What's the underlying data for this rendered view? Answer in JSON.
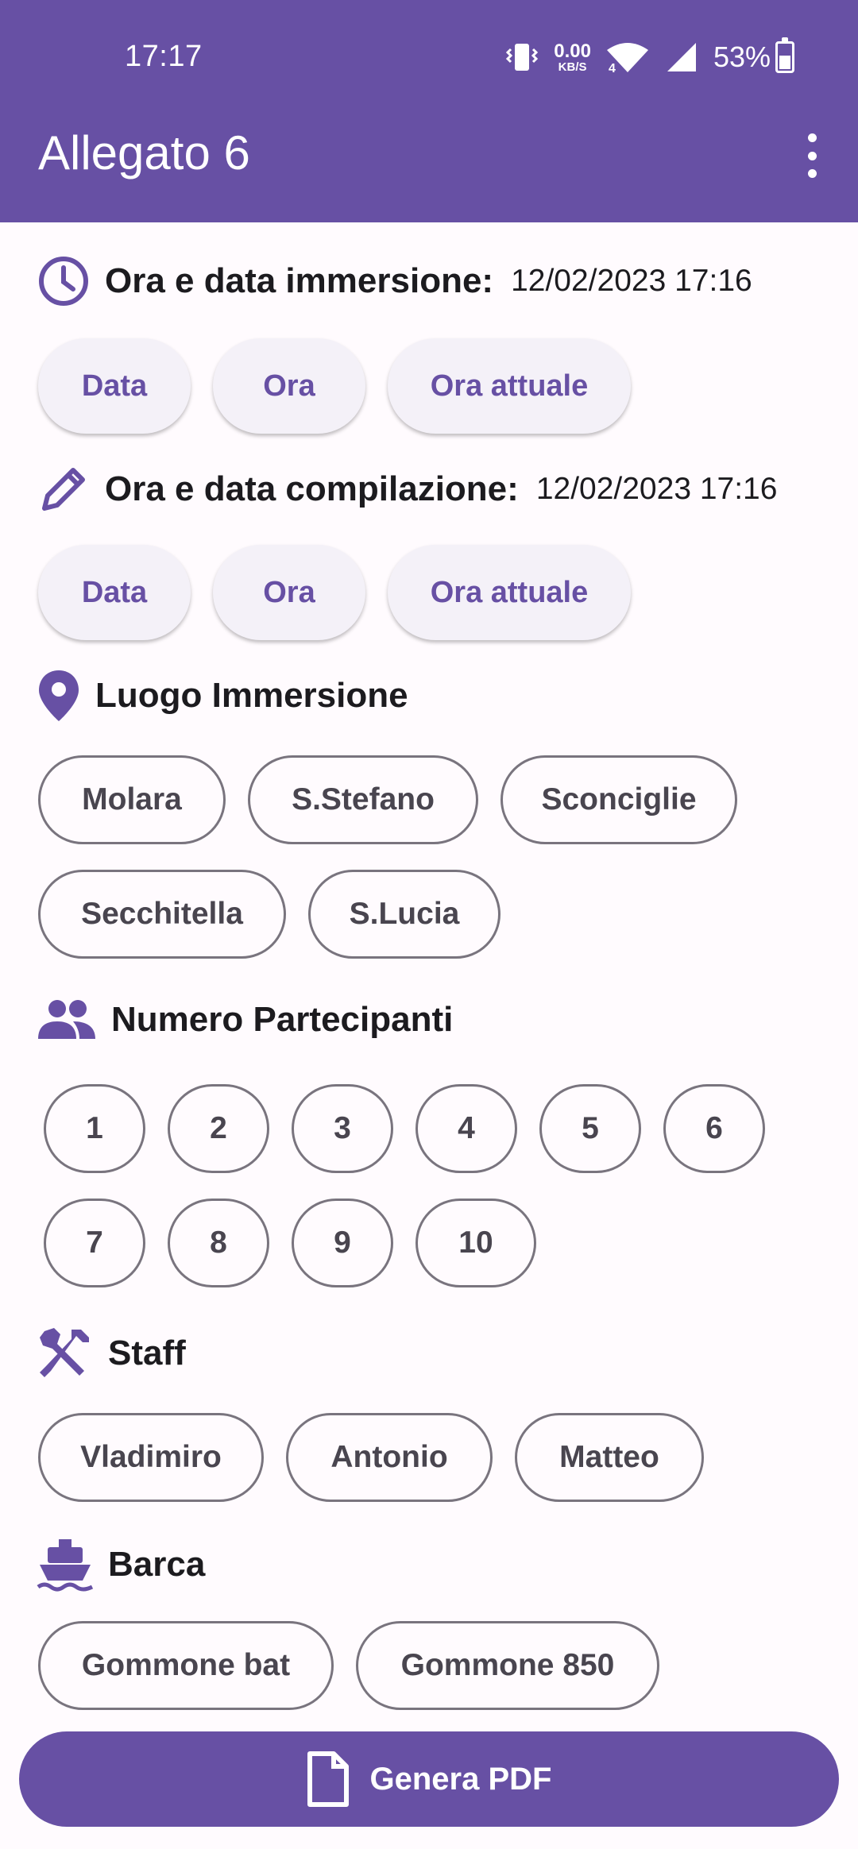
{
  "status_bar": {
    "time": "17:17",
    "net_speed": "0.00",
    "net_unit": "KB/S",
    "wifi_label": "4",
    "battery": "53%"
  },
  "app_bar": {
    "title": "Allegato 6",
    "menu_icon": "more-vert-icon"
  },
  "dive_time": {
    "icon": "clock-icon",
    "label": "Ora e data immersione:",
    "value": "12/02/2023 17:16",
    "buttons": {
      "date": "Data",
      "time": "Ora",
      "now": "Ora attuale"
    }
  },
  "fill_time": {
    "icon": "pencil-icon",
    "label": "Ora e data compilazione:",
    "value": "12/02/2023 17:16",
    "buttons": {
      "date": "Data",
      "time": "Ora",
      "now": "Ora attuale"
    }
  },
  "location": {
    "icon": "location-pin-icon",
    "label": "Luogo Immersione",
    "options": [
      "Molara",
      "S.Stefano",
      "Sconciglie",
      "Secchitella",
      "S.Lucia"
    ]
  },
  "participants": {
    "icon": "group-icon",
    "label": "Numero Partecipanti",
    "options": [
      "1",
      "2",
      "3",
      "4",
      "5",
      "6",
      "7",
      "8",
      "9",
      "10"
    ]
  },
  "staff": {
    "icon": "tools-icon",
    "label": "Staff",
    "options": [
      "Vladimiro",
      "Antonio",
      "Matteo"
    ]
  },
  "boat": {
    "icon": "boat-icon",
    "label": "Barca",
    "options": [
      "Gommone bat",
      "Gommone 850"
    ]
  },
  "generate_pdf": {
    "icon": "document-icon",
    "label": "Genera PDF"
  },
  "colors": {
    "primary": "#6750a4",
    "surface": "#fffbfe",
    "outline": "#79747e"
  }
}
